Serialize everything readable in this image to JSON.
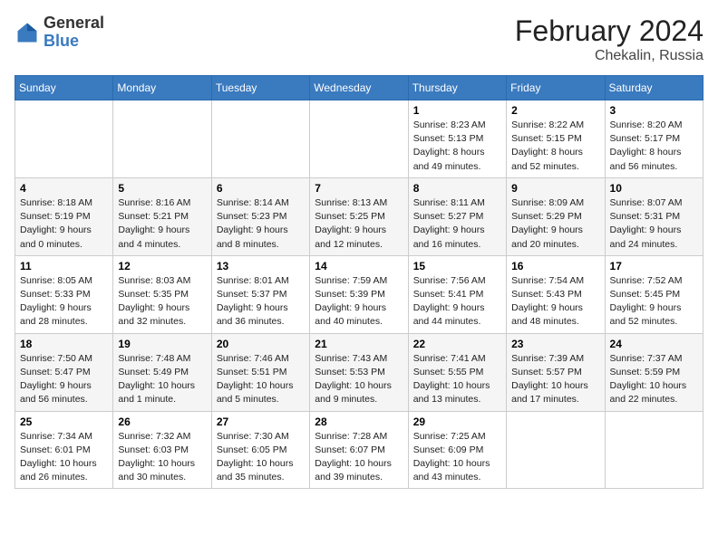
{
  "header": {
    "logo_general": "General",
    "logo_blue": "Blue",
    "month_title": "February 2024",
    "location": "Chekalin, Russia"
  },
  "weekdays": [
    "Sunday",
    "Monday",
    "Tuesday",
    "Wednesday",
    "Thursday",
    "Friday",
    "Saturday"
  ],
  "weeks": [
    [
      {
        "day": "",
        "info": ""
      },
      {
        "day": "",
        "info": ""
      },
      {
        "day": "",
        "info": ""
      },
      {
        "day": "",
        "info": ""
      },
      {
        "day": "1",
        "info": "Sunrise: 8:23 AM\nSunset: 5:13 PM\nDaylight: 8 hours\nand 49 minutes."
      },
      {
        "day": "2",
        "info": "Sunrise: 8:22 AM\nSunset: 5:15 PM\nDaylight: 8 hours\nand 52 minutes."
      },
      {
        "day": "3",
        "info": "Sunrise: 8:20 AM\nSunset: 5:17 PM\nDaylight: 8 hours\nand 56 minutes."
      }
    ],
    [
      {
        "day": "4",
        "info": "Sunrise: 8:18 AM\nSunset: 5:19 PM\nDaylight: 9 hours\nand 0 minutes."
      },
      {
        "day": "5",
        "info": "Sunrise: 8:16 AM\nSunset: 5:21 PM\nDaylight: 9 hours\nand 4 minutes."
      },
      {
        "day": "6",
        "info": "Sunrise: 8:14 AM\nSunset: 5:23 PM\nDaylight: 9 hours\nand 8 minutes."
      },
      {
        "day": "7",
        "info": "Sunrise: 8:13 AM\nSunset: 5:25 PM\nDaylight: 9 hours\nand 12 minutes."
      },
      {
        "day": "8",
        "info": "Sunrise: 8:11 AM\nSunset: 5:27 PM\nDaylight: 9 hours\nand 16 minutes."
      },
      {
        "day": "9",
        "info": "Sunrise: 8:09 AM\nSunset: 5:29 PM\nDaylight: 9 hours\nand 20 minutes."
      },
      {
        "day": "10",
        "info": "Sunrise: 8:07 AM\nSunset: 5:31 PM\nDaylight: 9 hours\nand 24 minutes."
      }
    ],
    [
      {
        "day": "11",
        "info": "Sunrise: 8:05 AM\nSunset: 5:33 PM\nDaylight: 9 hours\nand 28 minutes."
      },
      {
        "day": "12",
        "info": "Sunrise: 8:03 AM\nSunset: 5:35 PM\nDaylight: 9 hours\nand 32 minutes."
      },
      {
        "day": "13",
        "info": "Sunrise: 8:01 AM\nSunset: 5:37 PM\nDaylight: 9 hours\nand 36 minutes."
      },
      {
        "day": "14",
        "info": "Sunrise: 7:59 AM\nSunset: 5:39 PM\nDaylight: 9 hours\nand 40 minutes."
      },
      {
        "day": "15",
        "info": "Sunrise: 7:56 AM\nSunset: 5:41 PM\nDaylight: 9 hours\nand 44 minutes."
      },
      {
        "day": "16",
        "info": "Sunrise: 7:54 AM\nSunset: 5:43 PM\nDaylight: 9 hours\nand 48 minutes."
      },
      {
        "day": "17",
        "info": "Sunrise: 7:52 AM\nSunset: 5:45 PM\nDaylight: 9 hours\nand 52 minutes."
      }
    ],
    [
      {
        "day": "18",
        "info": "Sunrise: 7:50 AM\nSunset: 5:47 PM\nDaylight: 9 hours\nand 56 minutes."
      },
      {
        "day": "19",
        "info": "Sunrise: 7:48 AM\nSunset: 5:49 PM\nDaylight: 10 hours\nand 1 minute."
      },
      {
        "day": "20",
        "info": "Sunrise: 7:46 AM\nSunset: 5:51 PM\nDaylight: 10 hours\nand 5 minutes."
      },
      {
        "day": "21",
        "info": "Sunrise: 7:43 AM\nSunset: 5:53 PM\nDaylight: 10 hours\nand 9 minutes."
      },
      {
        "day": "22",
        "info": "Sunrise: 7:41 AM\nSunset: 5:55 PM\nDaylight: 10 hours\nand 13 minutes."
      },
      {
        "day": "23",
        "info": "Sunrise: 7:39 AM\nSunset: 5:57 PM\nDaylight: 10 hours\nand 17 minutes."
      },
      {
        "day": "24",
        "info": "Sunrise: 7:37 AM\nSunset: 5:59 PM\nDaylight: 10 hours\nand 22 minutes."
      }
    ],
    [
      {
        "day": "25",
        "info": "Sunrise: 7:34 AM\nSunset: 6:01 PM\nDaylight: 10 hours\nand 26 minutes."
      },
      {
        "day": "26",
        "info": "Sunrise: 7:32 AM\nSunset: 6:03 PM\nDaylight: 10 hours\nand 30 minutes."
      },
      {
        "day": "27",
        "info": "Sunrise: 7:30 AM\nSunset: 6:05 PM\nDaylight: 10 hours\nand 35 minutes."
      },
      {
        "day": "28",
        "info": "Sunrise: 7:28 AM\nSunset: 6:07 PM\nDaylight: 10 hours\nand 39 minutes."
      },
      {
        "day": "29",
        "info": "Sunrise: 7:25 AM\nSunset: 6:09 PM\nDaylight: 10 hours\nand 43 minutes."
      },
      {
        "day": "",
        "info": ""
      },
      {
        "day": "",
        "info": ""
      }
    ]
  ]
}
